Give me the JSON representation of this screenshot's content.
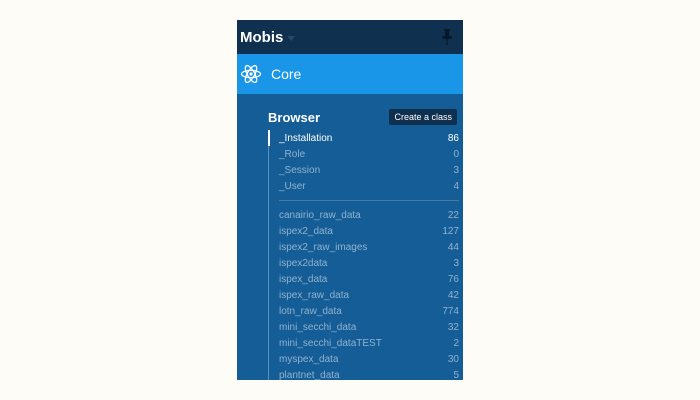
{
  "app": {
    "name": "Mobis"
  },
  "section": {
    "label": "Core"
  },
  "browser": {
    "title": "Browser",
    "create_label": "Create a class",
    "system_classes": [
      {
        "name": "_Installation",
        "count": "86"
      },
      {
        "name": "_Role",
        "count": "0"
      },
      {
        "name": "_Session",
        "count": "3"
      },
      {
        "name": "_User",
        "count": "4"
      }
    ],
    "user_classes": [
      {
        "name": "canairio_raw_data",
        "count": "22"
      },
      {
        "name": "ispex2_data",
        "count": "127"
      },
      {
        "name": "ispex2_raw_images",
        "count": "44"
      },
      {
        "name": "ispex2data",
        "count": "3"
      },
      {
        "name": "ispex_data",
        "count": "76"
      },
      {
        "name": "ispex_raw_data",
        "count": "42"
      },
      {
        "name": "lotn_raw_data",
        "count": "774"
      },
      {
        "name": "mini_secchi_data",
        "count": "32"
      },
      {
        "name": "mini_secchi_dataTEST",
        "count": "2"
      },
      {
        "name": "myspex_data",
        "count": "30"
      },
      {
        "name": "plantnet_data",
        "count": "5"
      }
    ]
  },
  "icons": {
    "app_caret": "chevron-down-icon",
    "pin": "pin-icon",
    "core": "atom-icon"
  },
  "colors": {
    "sidebar": "#155d96",
    "topbar": "#10304f",
    "core_active": "#1a96e9"
  }
}
